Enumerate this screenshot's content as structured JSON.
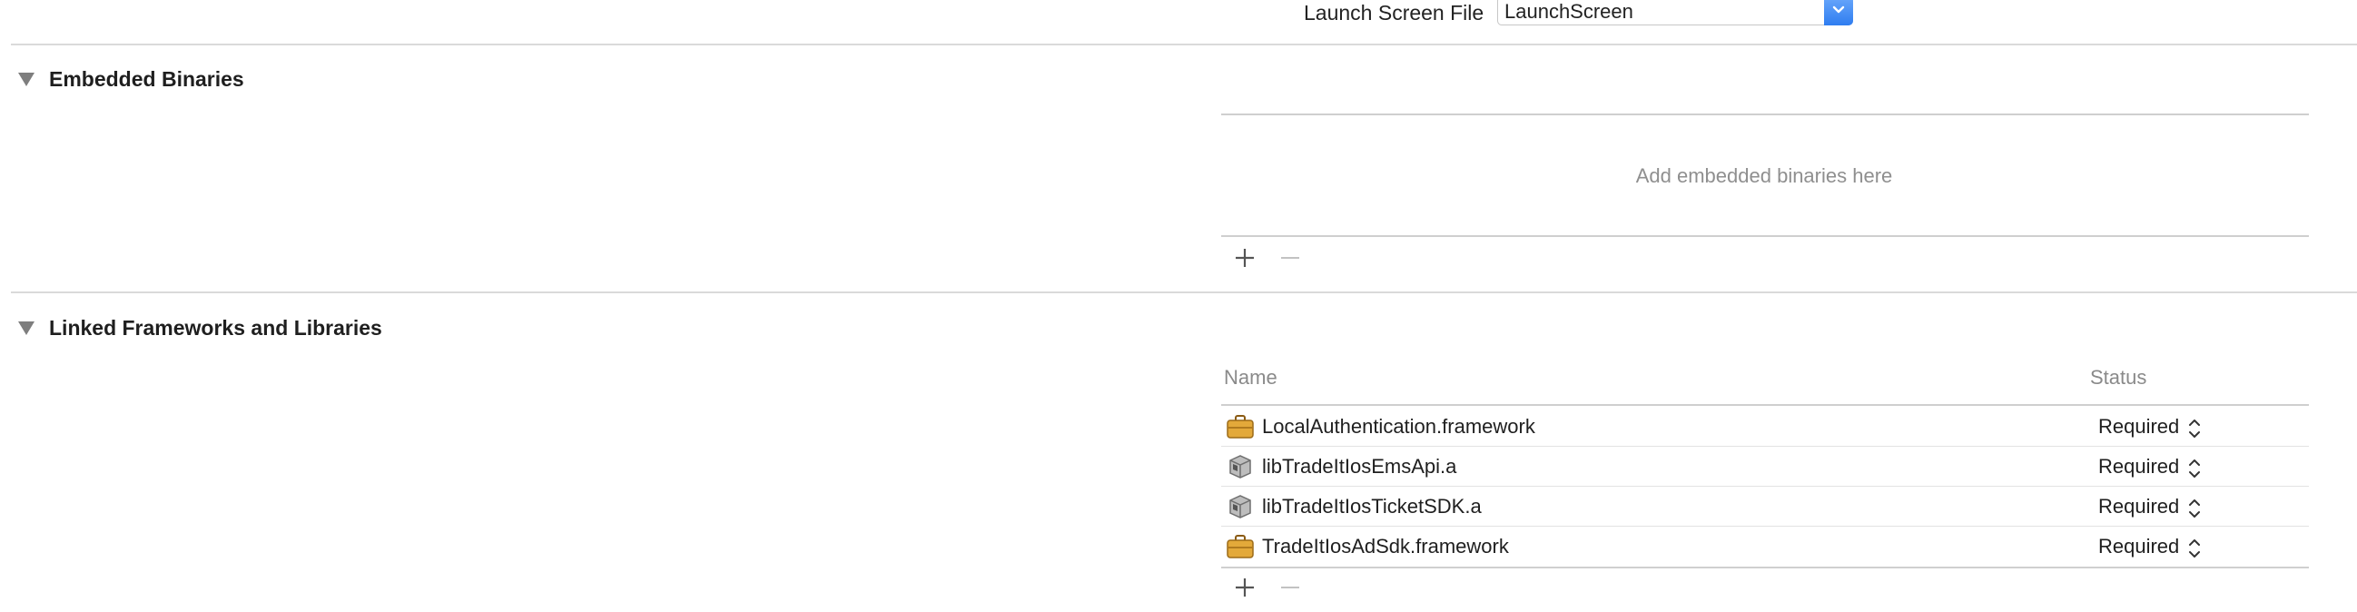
{
  "general": {
    "launch_screen_label": "Launch Screen File",
    "launch_screen_value": "LaunchScreen"
  },
  "embedded_binaries": {
    "title": "Embedded Binaries",
    "placeholder": "Add embedded binaries here"
  },
  "linked_frameworks": {
    "title": "Linked Frameworks and Libraries",
    "columns": {
      "name": "Name",
      "status": "Status"
    },
    "rows": [
      {
        "name": "LocalAuthentication.framework",
        "status": "Required",
        "icon": "framework-toolbox-icon"
      },
      {
        "name": "libTradeItIosEmsApi.a",
        "status": "Required",
        "icon": "static-library-icon"
      },
      {
        "name": "libTradeItIosTicketSDK.a",
        "status": "Required",
        "icon": "static-library-icon"
      },
      {
        "name": "TradeItIosAdSdk.framework",
        "status": "Required",
        "icon": "framework-toolbox-icon"
      }
    ]
  },
  "colors": {
    "accent_blue": "#3b86f5",
    "framework_icon": "#e3a93a",
    "separator": "#dadada"
  }
}
